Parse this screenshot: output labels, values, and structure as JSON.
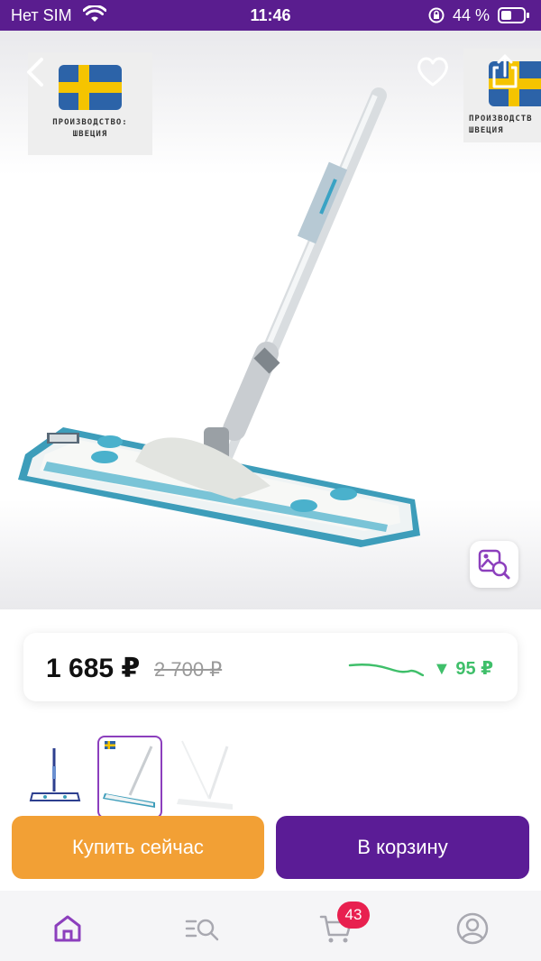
{
  "status_bar": {
    "carrier": "Нет SIM",
    "time": "11:46",
    "battery": "44 %"
  },
  "product": {
    "badge_text_left": [
      "ПРОИЗВОДСТВО:",
      "ШВЕЦИЯ"
    ],
    "badge_text_right": [
      "ПРОИЗВОДСТВ",
      "ШВЕЦИЯ"
    ],
    "price": "1 685 ₽",
    "old_price": "2 700 ₽",
    "price_drop": "▼ 95 ₽",
    "thumbnails": 3,
    "selected_thumbnail": 2
  },
  "actions": {
    "buy_now": "Купить сейчас",
    "add_to_cart": "В корзину"
  },
  "nav": {
    "items": [
      "home-icon",
      "catalog-search-icon",
      "cart-icon",
      "profile-icon"
    ],
    "active": "home",
    "cart_count": "43"
  },
  "colors": {
    "status_bar": "#5a1d8f",
    "accent_purple": "#5b1c96",
    "buy_orange": "#f2a035",
    "drop_green": "#3fbf6a",
    "badge_red": "#e8204f"
  }
}
